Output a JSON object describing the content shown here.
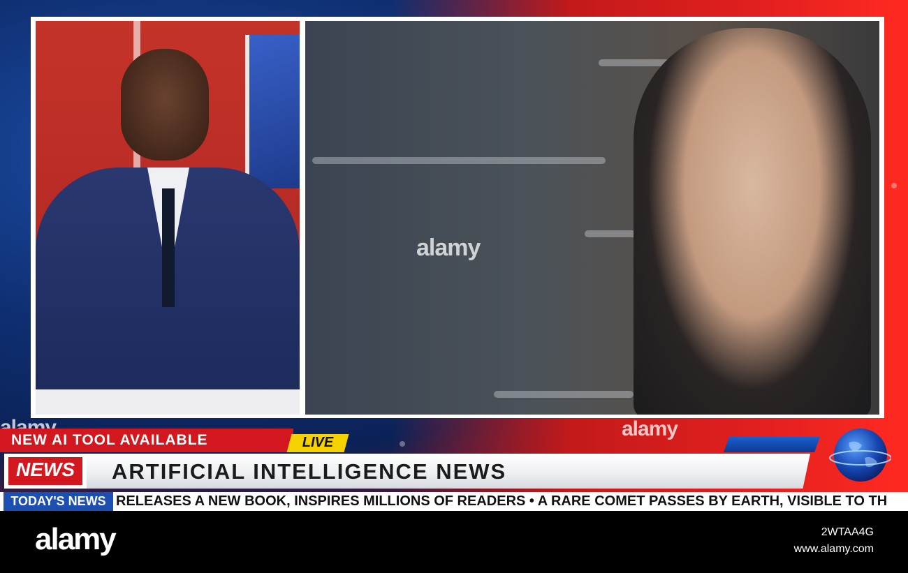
{
  "lower_third": {
    "headline": "NEW AI TOOL AVAILABLE",
    "live_label": "LIVE",
    "news_label": "NEWS",
    "main_title": "ARTIFICIAL INTELLIGENCE NEWS"
  },
  "ticker": {
    "label": "TODAY'S NEWS",
    "text": "RELEASES A NEW BOOK, INSPIRES MILLIONS OF READERS • A RARE COMET PASSES BY EARTH, VISIBLE TO TH"
  },
  "watermarks": {
    "mid": "alamy",
    "top_left": "alamy",
    "top_right": "alamy"
  },
  "footer": {
    "logo": "alamy",
    "image_id": "2WTAA4G",
    "url": "www.alamy.com"
  },
  "colors": {
    "news_red": "#d2181e",
    "live_yellow": "#f6d200",
    "ticker_blue": "#1d4fb0"
  }
}
